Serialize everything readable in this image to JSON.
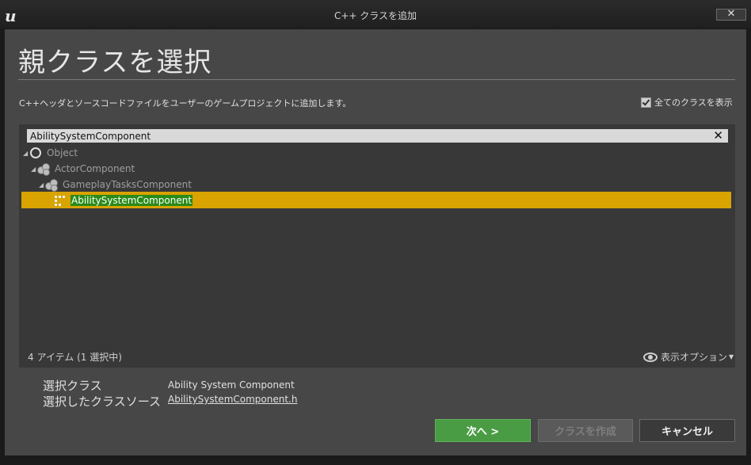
{
  "window": {
    "title": "C++ クラスを追加",
    "logo_icon": "unreal-engine-logo-icon",
    "close_label": "✕"
  },
  "header": {
    "heading": "親クラスを選択",
    "description": "C++ヘッダとソースコードファイルをユーザーのゲームプロジェクトに追加します。",
    "show_all_label": "全てのクラスを表示",
    "show_all_checked": true
  },
  "search": {
    "value": "AbilitySystemComponent",
    "clear_label": "✕"
  },
  "tree": {
    "items": [
      {
        "label": "Object",
        "icon": "object-circle-icon"
      },
      {
        "label": "ActorComponent",
        "icon": "component-gears-icon"
      },
      {
        "label": "GameplayTasksComponent",
        "icon": "component-gears-icon"
      },
      {
        "label": "AbilitySystemComponent",
        "icon": "dotted-grid-icon",
        "selected": true
      }
    ]
  },
  "status": {
    "count_text": "4 アイテム (1 選択中)",
    "view_options_label": "表示オプション"
  },
  "selection_info": {
    "class_label": "選択クラス",
    "class_value": "Ability System Component",
    "source_label": "選択したクラスソース",
    "source_value": "AbilitySystemComponent.h"
  },
  "buttons": {
    "next": "次へ >",
    "create": "クラスを作成",
    "cancel": "キャンセル"
  },
  "colors": {
    "selection_highlight": "#d9a300",
    "selected_text_bg": "#2a8a18",
    "next_button": "#4a9c44"
  }
}
